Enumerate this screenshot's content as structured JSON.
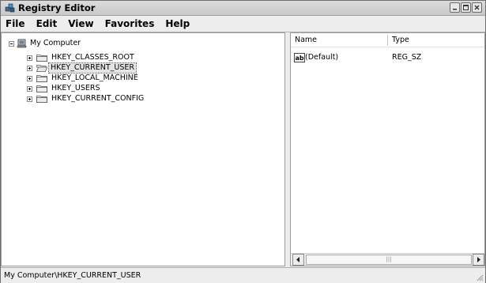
{
  "window": {
    "title": "Registry Editor"
  },
  "menu": [
    "File",
    "Edit",
    "View",
    "Favorites",
    "Help"
  ],
  "tree": {
    "root": "My Computer",
    "keys": [
      {
        "label": "HKEY_CLASSES_ROOT",
        "selected": false
      },
      {
        "label": "HKEY_CURRENT_USER",
        "selected": true
      },
      {
        "label": "HKEY_LOCAL_MACHINE",
        "selected": false
      },
      {
        "label": "HKEY_USERS",
        "selected": false
      },
      {
        "label": "HKEY_CURRENT_CONFIG",
        "selected": false
      }
    ]
  },
  "list": {
    "columns": [
      "Name",
      "Type"
    ],
    "rows": [
      {
        "icon": "ab",
        "name": "(Default)",
        "type": "REG_SZ"
      }
    ]
  },
  "scrollbar": {
    "thumb_grip": "|||"
  },
  "status": {
    "path": "My Computer\\HKEY_CURRENT_USER"
  }
}
